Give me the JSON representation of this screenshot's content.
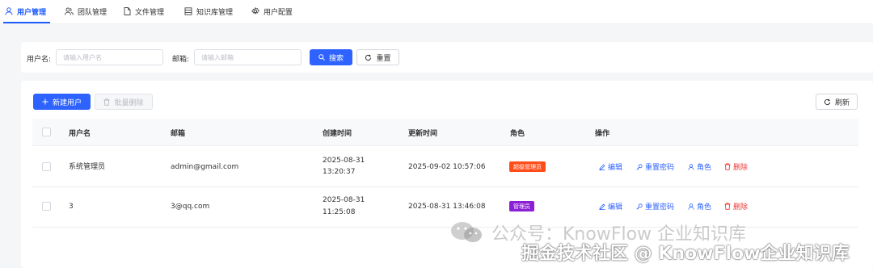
{
  "tabs": [
    {
      "label": "用户管理",
      "icon": "user-icon",
      "active": true
    },
    {
      "label": "团队管理",
      "icon": "team-icon",
      "active": false
    },
    {
      "label": "文件管理",
      "icon": "file-icon",
      "active": false
    },
    {
      "label": "知识库管理",
      "icon": "database-icon",
      "active": false
    },
    {
      "label": "用户配置",
      "icon": "gear-icon",
      "active": false
    }
  ],
  "filter": {
    "username_label": "用户名:",
    "username_placeholder": "请输入用户名",
    "email_label": "邮箱:",
    "email_placeholder": "请输入邮箱",
    "search_label": "搜索",
    "reset_label": "重置"
  },
  "toolbar": {
    "new_user_label": "新建用户",
    "batch_delete_label": "批量删除",
    "refresh_label": "刷新"
  },
  "table": {
    "columns": [
      "用户名",
      "邮箱",
      "创建时间",
      "更新时间",
      "角色",
      "操作"
    ],
    "rows": [
      {
        "username": "系统管理员",
        "email": "admin@gmail.com",
        "created_date": "2025-08-31",
        "created_time": "13:20:37",
        "updated": "2025-09-02 10:57:06",
        "role": "超级管理员",
        "role_color": "#ff4d1a"
      },
      {
        "username": "3",
        "email": "3@qq.com",
        "created_date": "2025-08-31",
        "created_time": "11:25:08",
        "updated": "2025-08-31 13:46:08",
        "role": "管理员",
        "role_color": "#8b1fd6"
      }
    ],
    "actions": {
      "edit": "编辑",
      "reset_password": "重置密码",
      "role": "角色",
      "delete": "删除"
    }
  },
  "watermark": {
    "line1": "公众号：KnowFlow 企业知识库",
    "line2": "掘金技术社区 @ KnowFlow企业知识库"
  },
  "colors": {
    "primary": "#2f63ff",
    "danger": "#ee3b3b"
  }
}
